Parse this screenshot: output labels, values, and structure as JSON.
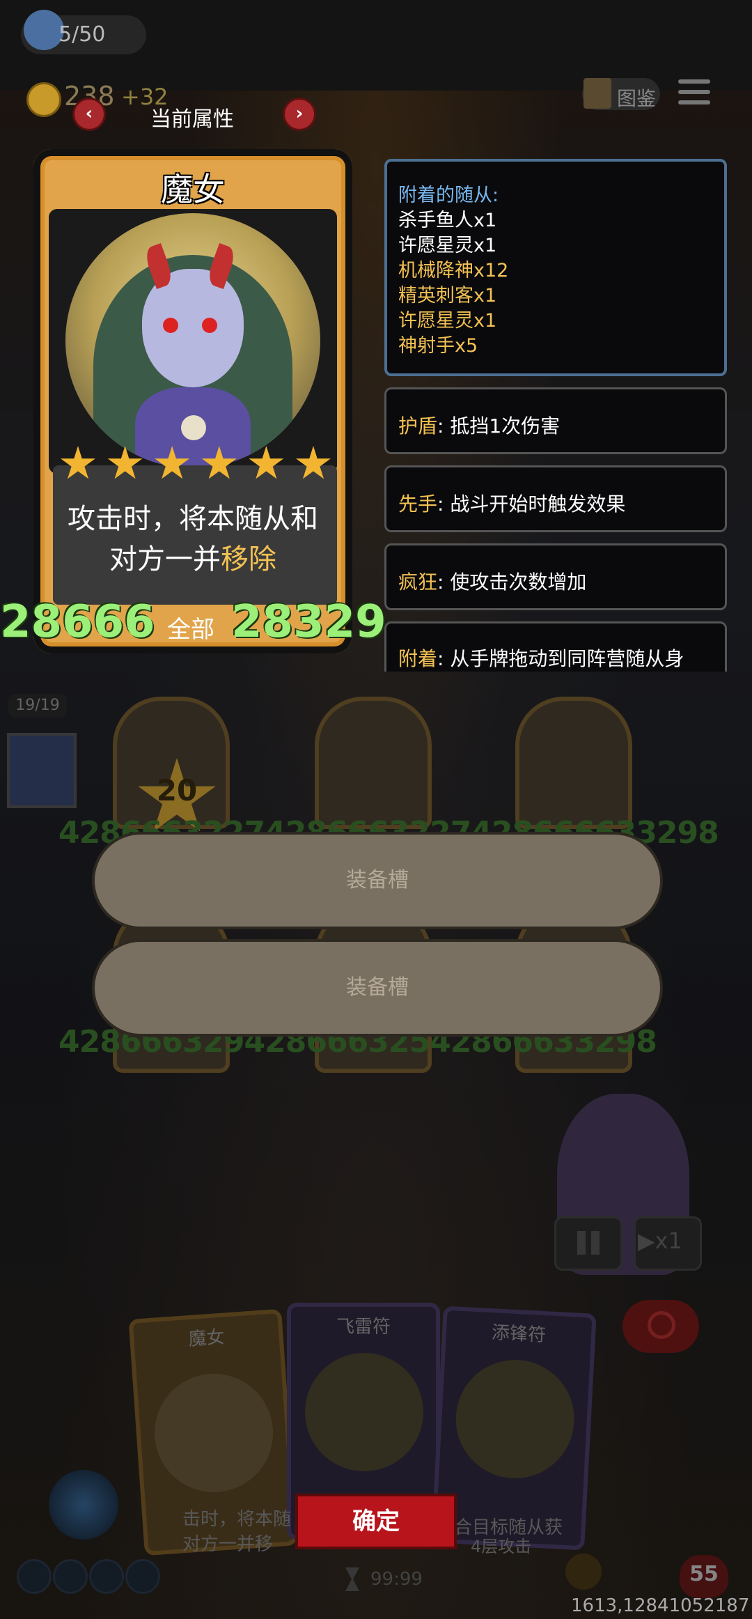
{
  "top_bar": {
    "population": "5/50",
    "gold": "238",
    "gold_bonus": "+32",
    "codex_label": "图鉴"
  },
  "attr_header": {
    "title": "当前属性",
    "prev": "‹",
    "next": "›"
  },
  "card": {
    "name": "魔女",
    "stars": 6,
    "desc_line1": "攻击时，将本随从和",
    "desc_line2_prefix": "对方一并",
    "desc_line2_highlight": "移除",
    "attack": "28666",
    "all_label": "全部",
    "health": "28329"
  },
  "attached_minions": {
    "title": "附着的随从:",
    "items": [
      "杀手鱼人x1",
      "许愿星灵x1",
      "机械降神x12",
      "精英刺客x1",
      "许愿星灵x1",
      "神射手x5"
    ],
    "colors": [
      "#ffffff",
      "#ffffff",
      "#f4c253",
      "#f4c253",
      "#f4c253",
      "#f4c253"
    ]
  },
  "keywords": [
    {
      "name": "护盾",
      "desc": ": 抵挡1次伤害"
    },
    {
      "name": "先手",
      "desc": ": 战斗开始时触发效果"
    },
    {
      "name": "疯狂",
      "desc": ": 使攻击次数增加"
    },
    {
      "name": "附着",
      "desc": ": 从手牌拖动到同阵营随从身"
    }
  ],
  "board": {
    "badge": "19/19",
    "star_value": "20",
    "row1_numbers": "42866632274286663227428666633298",
    "row2_numbers": "42866632942866632542866633298"
  },
  "equip_slots": [
    "装备槽",
    "装备槽"
  ],
  "controls": {
    "speed_label": "▶x1"
  },
  "hand": {
    "cards": [
      "魔女",
      "飞雷符",
      "添锋符"
    ],
    "desc1": "击时，将本随",
    "desc2": "对方一并移",
    "desc3": "合目标随从获",
    "desc4": "4层攻击"
  },
  "confirm_label": "确定",
  "timer": "99:99",
  "hp": "55",
  "coords": "1613,12841052187",
  "colors": {
    "accent_gold": "#f4c253",
    "stat_green": "#9cf07a",
    "minion_title_blue": "#78b8f0",
    "confirm_red": "#b8141c"
  }
}
